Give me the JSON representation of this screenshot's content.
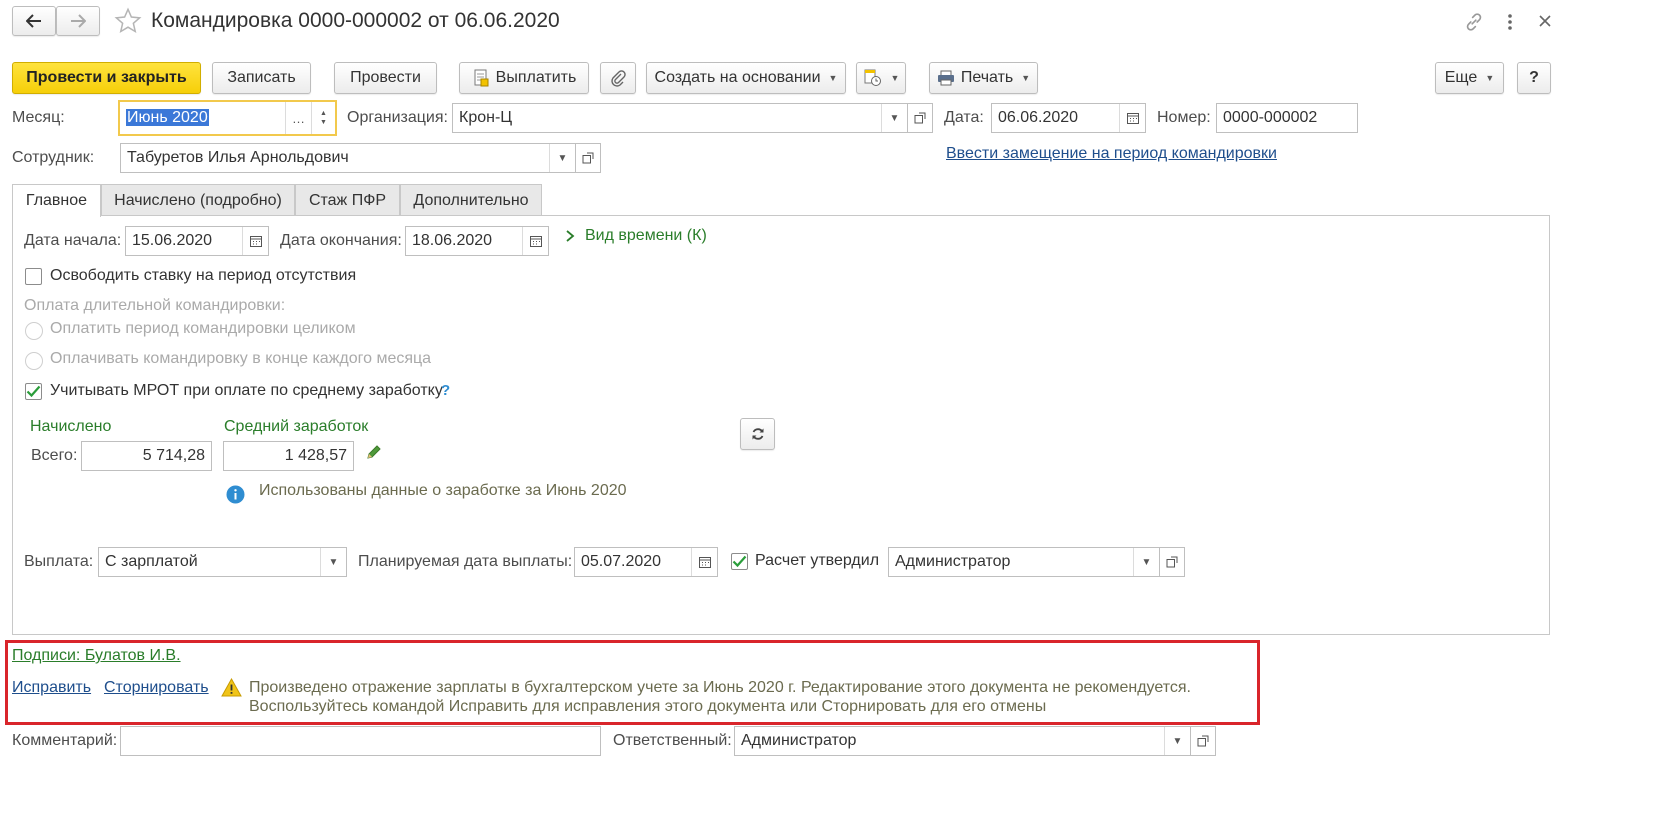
{
  "header": {
    "title": "Командировка 0000-000002 от 06.06.2020"
  },
  "toolbar": {
    "post_close": "Провести и закрыть",
    "save": "Записать",
    "post": "Провести",
    "pay": "Выплатить",
    "create_based": "Создать на основании",
    "print": "Печать",
    "more": "Еще",
    "help": "?"
  },
  "form": {
    "month_label": "Месяц:",
    "month_value": "Июнь 2020",
    "org_label": "Организация:",
    "org_value": "Крон-Ц",
    "date_label": "Дата:",
    "date_value": "06.06.2020",
    "number_label": "Номер:",
    "number_value": "0000-000002",
    "employee_label": "Сотрудник:",
    "employee_value": "Табуретов Илья Арнольдович",
    "substitution_link": "Ввести замещение на период командировки"
  },
  "tabs": [
    {
      "label": "Главное"
    },
    {
      "label": "Начислено (подробно)"
    },
    {
      "label": "Стаж ПФР"
    },
    {
      "label": "Дополнительно"
    }
  ],
  "main": {
    "start_label": "Дата начала:",
    "start_value": "15.06.2020",
    "end_label": "Дата окончания:",
    "end_value": "18.06.2020",
    "time_type": "Вид времени (К)",
    "free_rate": "Освободить ставку на период отсутствия",
    "long_trip_label": "Оплата длительной командировки:",
    "pay_whole": "Оплатить период командировки целиком",
    "pay_monthly": "Оплачивать командировку в конце каждого месяца",
    "mrot": "Учитывать МРОТ при оплате по среднему заработку",
    "mrot_help": "?",
    "accrued_link": "Начислено",
    "avg_link": "Средний заработок",
    "total_label": "Всего:",
    "accrued_value": "5 714,28",
    "avg_value": "1 428,57",
    "earnings_info": "Использованы данные о заработке за Июнь 2020",
    "payout_label": "Выплата:",
    "payout_value": "С зарплатой",
    "planned_label": "Планируемая дата выплаты:",
    "planned_value": "05.07.2020",
    "approved_label": "Расчет утвердил",
    "approved_value": "Администратор"
  },
  "footer": {
    "signatures": "Подписи: Булатов И.В.",
    "fix": "Исправить",
    "storno": "Сторнировать",
    "warning_line1": "Произведено отражение зарплаты в бухгалтерском учете за Июнь 2020 г. Редактирование этого документа не рекомендуется.",
    "warning_line2": "Воспользуйтесь командой Исправить для исправления этого документа или Сторнировать для его отмены",
    "comment_label": "Комментарий:",
    "comment_value": "",
    "responsible_label": "Ответственный:",
    "responsible_value": "Администратор"
  },
  "colors": {
    "primary_button": "#f6cf09",
    "highlight_frame": "#d9252b",
    "link": "#1e4e8c",
    "green_link": "#2a7d2a",
    "info_icon": "#2f8dd1",
    "warning_icon": "#f0c419"
  }
}
